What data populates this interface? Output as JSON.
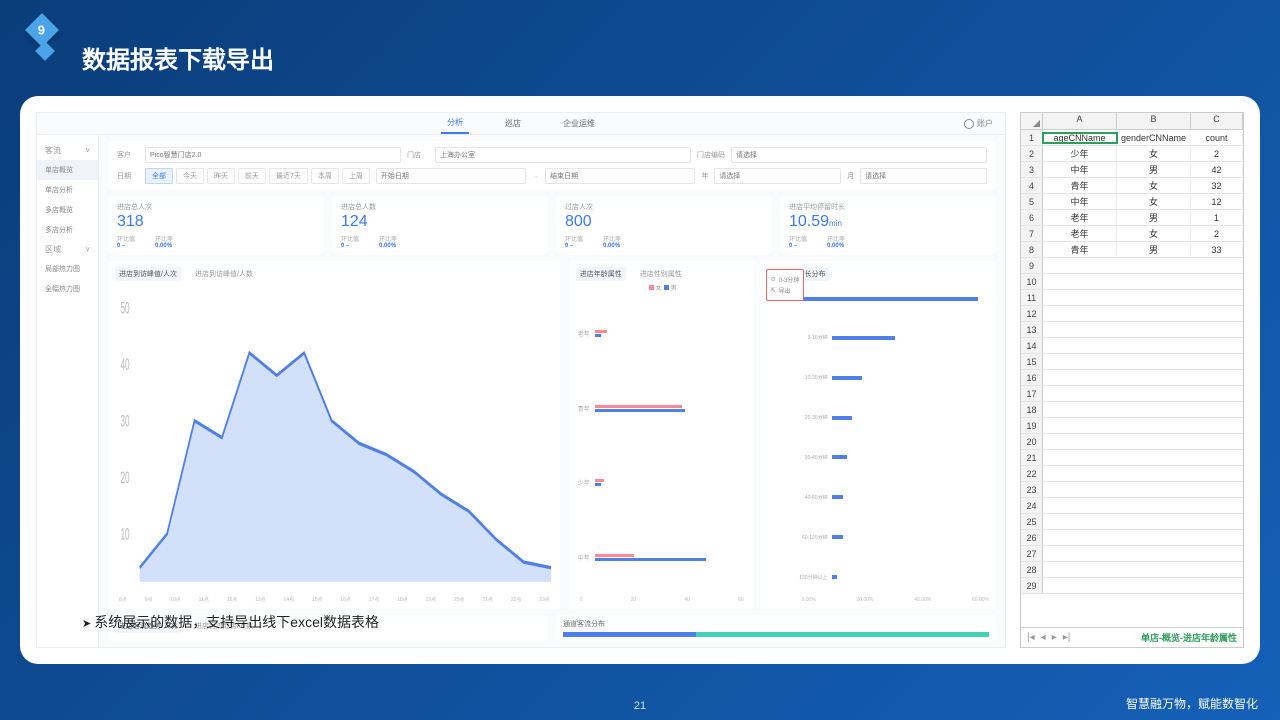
{
  "slide": {
    "number": "9",
    "title": "数据报表下载导出",
    "page": "21",
    "tagline": "智慧融万物，赋能数智化",
    "bullet": "系统展示的数据，支持导出线下excel数据表格"
  },
  "topbar": {
    "tab1": "分析",
    "tab2": "巡店",
    "tab3": "企业运维",
    "user": "账户"
  },
  "sidebar": {
    "g1": "客流",
    "i1": "单店概览",
    "i2": "单店分析",
    "i3": "多店概览",
    "i4": "多店分析",
    "g2": "区域",
    "i5": "局部热力图",
    "i6": "全幅热力图"
  },
  "filter": {
    "l1": "客户",
    "v1": "Pico智慧门店2.0",
    "l2": "门店",
    "v2": "上海办公室",
    "l3": "门店编码",
    "v3": "请选择",
    "l4": "日期",
    "d1": "全部",
    "d2": "今天",
    "d3": "昨天",
    "d4": "前天",
    "d5": "最近7天",
    "d6": "本周",
    "d7": "上周",
    "p1": "开始日期",
    "p2": "结束日期",
    "l5": "年",
    "v5": "请选择",
    "l6": "月",
    "v6": "请选择"
  },
  "kpi": [
    {
      "label": "进店总人次",
      "value": "318"
    },
    {
      "label": "进店总人数",
      "value": "124"
    },
    {
      "label": "过店人次",
      "value": "800"
    },
    {
      "label": "进店平均停留时长",
      "value": "10.59",
      "unit": "min"
    }
  ],
  "kcomp": {
    "a": "环比值",
    "av": "0 –",
    "b": "环比率",
    "bv": "0.00%"
  },
  "c1": {
    "t1": "进店到访峰值/人次",
    "t2": "进店到访峰值/人数"
  },
  "c2": {
    "t1": "进店年龄属性",
    "t2": "进店性别属性",
    "lf": "女",
    "lm": "男",
    "a1": "老年",
    "a2": "青年",
    "a3": "少年",
    "a4": "中年"
  },
  "c3": {
    "title": "进店停留时长分布",
    "m1": "0-3分钟",
    "m2": "导出",
    "r1": "3-10分钟",
    "r2": "10-20分钟",
    "r3": "20-30分钟",
    "r4": "30-40分钟",
    "r5": "40-60分钟",
    "r6": "60-120分钟",
    "r7": "120分钟以上",
    "x0": "0.00%",
    "x1": "20.00%",
    "x2": "40.00%",
    "x3": "60.00%"
  },
  "c4": {
    "t1": "进店客流趋势/人次",
    "t2": "进店客流趋势/人数"
  },
  "c5": {
    "title": "通道客流分布"
  },
  "chart_data": {
    "area": {
      "type": "area",
      "x": [
        "8点",
        "9点",
        "10点",
        "11点",
        "12点",
        "13点",
        "14点",
        "15点",
        "16点",
        "17点",
        "18点",
        "19点",
        "20点",
        "21点",
        "22点",
        "23点"
      ],
      "values": [
        2,
        8,
        28,
        25,
        40,
        36,
        40,
        28,
        24,
        22,
        20,
        17,
        13,
        10,
        6,
        4
      ],
      "ylim": [
        0,
        50
      ],
      "yticks": [
        10,
        20,
        30,
        40,
        50
      ]
    },
    "age": {
      "type": "bar",
      "orientation": "h",
      "categories": [
        "老年",
        "青年",
        "少年",
        "中年"
      ],
      "series": [
        {
          "name": "女",
          "values": [
            4,
            34,
            3,
            15
          ]
        },
        {
          "name": "男",
          "values": [
            2,
            35,
            2,
            44
          ]
        }
      ],
      "xlim": [
        0,
        60
      ],
      "xticks": [
        0,
        20,
        40,
        60
      ]
    },
    "duration": {
      "type": "bar",
      "orientation": "h",
      "categories": [
        "0-3分钟",
        "3-10分钟",
        "10-20分钟",
        "20-30分钟",
        "30-40分钟",
        "40-60分钟",
        "60-120分钟",
        "120分钟以上"
      ],
      "values": [
        58,
        20,
        9,
        6,
        4,
        3,
        3,
        1
      ],
      "unit": "%",
      "xlim": [
        0,
        60
      ]
    },
    "channel": {
      "type": "stacked-bar",
      "segments": [
        31,
        69
      ]
    }
  },
  "excel": {
    "cols": [
      "A",
      "B",
      "C"
    ],
    "head": [
      "ageCNName",
      "genderCNName",
      "count"
    ],
    "rows": [
      [
        "少年",
        "女",
        "2"
      ],
      [
        "中年",
        "男",
        "42"
      ],
      [
        "青年",
        "女",
        "32"
      ],
      [
        "中年",
        "女",
        "12"
      ],
      [
        "老年",
        "男",
        "1"
      ],
      [
        "老年",
        "女",
        "2"
      ],
      [
        "青年",
        "男",
        "33"
      ]
    ],
    "sheet": "单店-概览-进店年龄属性"
  }
}
